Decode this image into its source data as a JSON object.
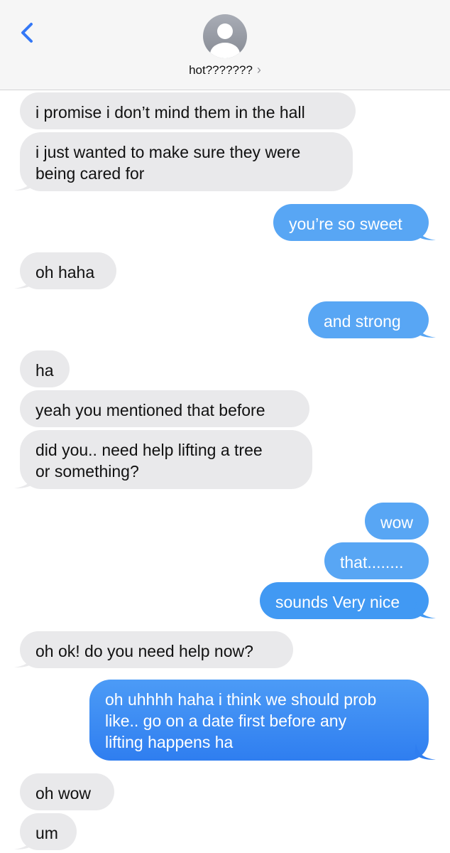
{
  "header": {
    "contact_name": "hot???????",
    "chevron": "›",
    "back_icon": "chevron-left-icon",
    "avatar_icon": "person-silhouette-icon",
    "accent_color": "#3478f6"
  },
  "messages": [
    {
      "direction": "incoming",
      "text": "i promise i don’t mind them in the hall"
    },
    {
      "direction": "incoming",
      "text": "i just wanted to make sure they were\nbeing cared for"
    },
    {
      "direction": "outgoing",
      "text": "you’re so sweet"
    },
    {
      "direction": "incoming",
      "text": "oh haha"
    },
    {
      "direction": "outgoing",
      "text": "and strong"
    },
    {
      "direction": "incoming",
      "text": "ha"
    },
    {
      "direction": "incoming",
      "text": "yeah you mentioned that before"
    },
    {
      "direction": "incoming",
      "text": "did you.. need help lifting a tree\nor something?"
    },
    {
      "direction": "outgoing",
      "text": "wow"
    },
    {
      "direction": "outgoing",
      "text": "that........"
    },
    {
      "direction": "outgoing",
      "text": "sounds Very nice"
    },
    {
      "direction": "incoming",
      "text": "oh ok! do you need help now?"
    },
    {
      "direction": "outgoing",
      "text": "oh uhhhh haha i think we should prob\nlike.. go on a date first before any\nlifting happens ha"
    },
    {
      "direction": "incoming",
      "text": "oh wow"
    },
    {
      "direction": "incoming",
      "text": "um"
    }
  ],
  "colors": {
    "incoming_bubble": "#e9e9eb",
    "outgoing_bubble": "#4199f3",
    "outgoing_bubble_dark": "#2f7ef0"
  }
}
